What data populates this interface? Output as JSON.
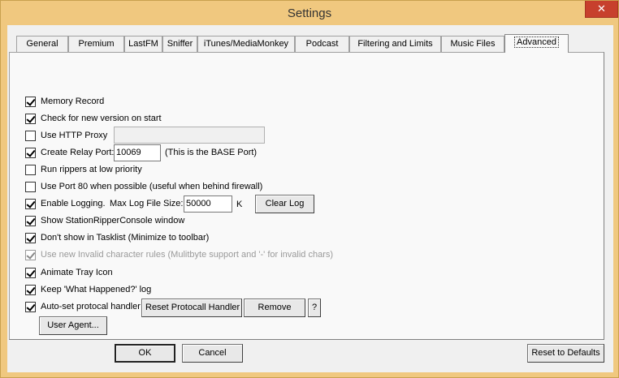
{
  "window": {
    "title": "Settings",
    "close_symbol": "✕"
  },
  "tabs": [
    {
      "label": "General"
    },
    {
      "label": "Premium"
    },
    {
      "label": "LastFM"
    },
    {
      "label": "Sniffer"
    },
    {
      "label": "iTunes/MediaMonkey"
    },
    {
      "label": "Podcast"
    },
    {
      "label": "Filtering and Limits"
    },
    {
      "label": "Music Files"
    },
    {
      "label": "Advanced",
      "active": true
    }
  ],
  "options": {
    "memory_record": {
      "label": "Memory Record",
      "checked": true
    },
    "check_version": {
      "label": "Check for new version on start",
      "checked": true
    },
    "http_proxy": {
      "label": "Use HTTP Proxy",
      "checked": false,
      "value": ""
    },
    "relay_port": {
      "label": "Create Relay Port:",
      "checked": true,
      "value": "10069",
      "note": "(This is the BASE Port)"
    },
    "low_priority": {
      "label": "Run rippers at low priority",
      "checked": false
    },
    "port80": {
      "label": "Use Port 80 when possible (useful when behind firewall)",
      "checked": false
    },
    "logging": {
      "label": "Enable Logging.",
      "checked": true,
      "max_label": "Max Log File Size:",
      "value": "50000",
      "unit": "K",
      "clear_button": "Clear Log"
    },
    "show_console": {
      "label": "Show StationRipperConsole window",
      "checked": true
    },
    "no_tasklist": {
      "label": "Don't show in Tasklist (Minimize to toolbar)",
      "checked": true
    },
    "invalid_chars": {
      "label": "Use new Invalid character rules (Mulitbyte support and '-' for invalid chars)",
      "checked": true,
      "disabled": true
    },
    "animate_tray": {
      "label": "Animate Tray Icon",
      "checked": true
    },
    "keep_log": {
      "label": "Keep 'What Happened?' log",
      "checked": true
    },
    "protocol_handler": {
      "label": "Auto-set protocal handler",
      "checked": true,
      "reset_button": "Reset Protocall Handler",
      "remove_button": "Remove",
      "help_button": "?"
    }
  },
  "user_agent_button": "User Agent...",
  "footer": {
    "ok": "OK",
    "cancel": "Cancel",
    "reset_defaults": "Reset to Defaults"
  }
}
